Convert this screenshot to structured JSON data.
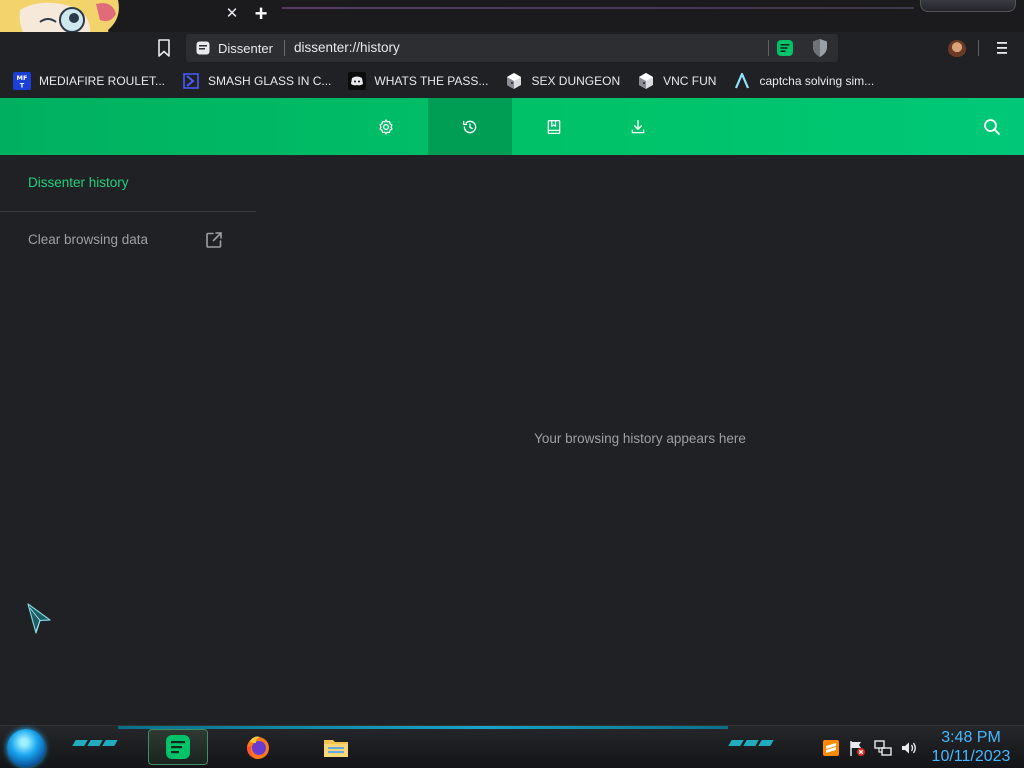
{
  "browser": {
    "tab": {
      "close_glyph": "✕"
    },
    "new_tab_glyph": "+",
    "site_chip_label": "Dissenter",
    "url": "dissenter://history",
    "menu_glyph": "⋮"
  },
  "bookmarks": [
    {
      "label": "MEDIAFIRE ROULET...",
      "icon": "mediafire-icon"
    },
    {
      "label": "SMASH GLASS IN C...",
      "icon": "chevron-logo-icon"
    },
    {
      "label": "WHATS THE PASS...",
      "icon": "discord-icon"
    },
    {
      "label": "SEX DUNGEON",
      "icon": "cube-icon"
    },
    {
      "label": "VNC FUN",
      "icon": "cube-icon"
    },
    {
      "label": "captcha solving sim...",
      "icon": "lambda-icon"
    }
  ],
  "header": {
    "tabs": [
      {
        "name": "settings",
        "icon": "gear-icon",
        "active": false
      },
      {
        "name": "history",
        "icon": "history-icon",
        "active": true
      },
      {
        "name": "bookmarks",
        "icon": "bookmark-book-icon",
        "active": false
      },
      {
        "name": "downloads",
        "icon": "download-icon",
        "active": false
      }
    ],
    "accent": "#00c369",
    "active_bg": "#009e55"
  },
  "sidebar": {
    "title": "Dissenter history",
    "clear_label": "Clear browsing data"
  },
  "main": {
    "empty_message": "Your browsing history appears here"
  },
  "taskbar": {
    "time": "3:48 PM",
    "date": "10/11/2023",
    "apps": [
      "dissenter-icon",
      "firefox-icon",
      "file-explorer-icon"
    ],
    "tray": [
      "sublime-text-icon",
      "flag-alert-icon",
      "network-icon",
      "volume-icon"
    ]
  },
  "colors": {
    "page_bg": "#202124",
    "sidebar_title": "#1fd17d",
    "muted_text": "#9aa0a6",
    "clock": "#46b8ff"
  }
}
